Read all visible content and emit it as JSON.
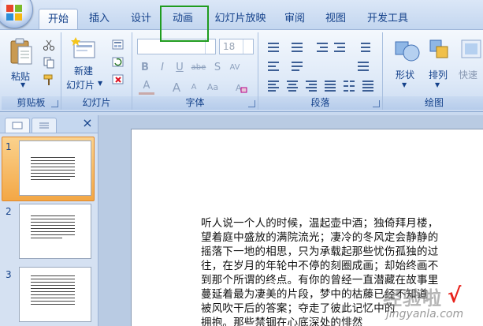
{
  "tabs": [
    {
      "label": "开始",
      "active": true
    },
    {
      "label": "插入",
      "active": false
    },
    {
      "label": "设计",
      "active": false
    },
    {
      "label": "动画",
      "active": false,
      "highlighted": true
    },
    {
      "label": "幻灯片放映",
      "active": false
    },
    {
      "label": "审阅",
      "active": false
    },
    {
      "label": "视图",
      "active": false
    },
    {
      "label": "开发工具",
      "active": false
    }
  ],
  "highlight_color": "#1f9c1f",
  "ribbon": {
    "clipboard": {
      "paste_label": "粘贴",
      "group_label": "剪贴板"
    },
    "slides": {
      "new_slide_line1": "新建",
      "new_slide_line2": "幻灯片",
      "group_label": "幻灯片"
    },
    "font": {
      "font_name_value": "",
      "font_size_value": "18",
      "bold": "B",
      "italic": "I",
      "underline": "U",
      "strike": "abe",
      "shadow": "S",
      "spacing": "AV",
      "case": "Aa",
      "color": "A",
      "grow": "A",
      "shrink": "A",
      "group_label": "字体"
    },
    "paragraph": {
      "group_label": "段落"
    },
    "drawing": {
      "shape_label": "形状",
      "arrange_label": "排列",
      "quick_styles_label": "快速",
      "group_label": "绘图"
    }
  },
  "slides_panel": {
    "thumbnails": [
      {
        "number": "1",
        "selected": true
      },
      {
        "number": "2",
        "selected": false
      },
      {
        "number": "3",
        "selected": false
      }
    ],
    "close_icon": "×"
  },
  "slide": {
    "lines": [
      "听人说一个人的时候，温起壶中酒；独倚拜月楼，",
      "望着庭中盛放的满院流光；凄冷的冬风定会静静的",
      "摇落下一地的相思，只为承载起那些忧伤孤独的过",
      "往，在岁月的年轮中不停的刻圈成画；却始终画不",
      "到那个所谓的终点。有你的曾经一直潜藏在故事里",
      "蔓延着最为凄美的片段，梦中的枯藤已经不知道",
      "被风吹干后的答案；夺走了彼此记忆中的",
      "拥抱。那些禁锢在心底深处的悱然"
    ]
  },
  "watermark": {
    "main": "经验啦",
    "check": "√",
    "sub": "jingyanla.com"
  },
  "accent_colors": {
    "ribbon_text": "#15428b",
    "selected_thumb": "#f3a745"
  }
}
